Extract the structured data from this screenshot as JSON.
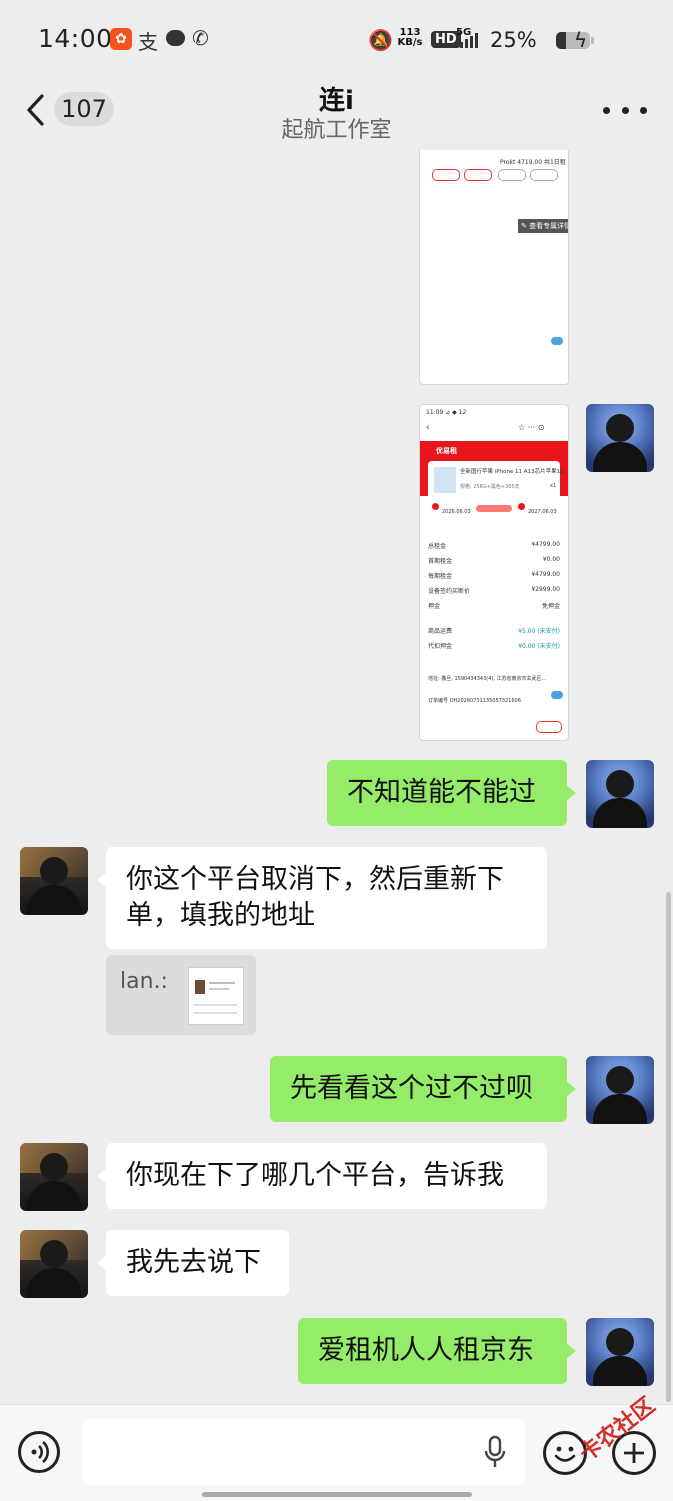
{
  "status_bar": {
    "time": "14:00",
    "app1": "😀",
    "alipay": "支",
    "network_speed_value": "113",
    "network_speed_unit": "KB/s",
    "hd": "HD",
    "signal": "5G",
    "battery": "25%"
  },
  "header": {
    "unread_count": "107",
    "title": "连i",
    "subtitle": "起航工作室"
  },
  "messages": [
    {
      "side": "me",
      "type": "image",
      "description": "partial order screenshot"
    },
    {
      "side": "me",
      "type": "image",
      "description": "order detail screenshot"
    },
    {
      "side": "me",
      "type": "text",
      "text": "不知道能不能过"
    },
    {
      "side": "other",
      "type": "text",
      "text": "你这个平台取消下，然后重新下单，填我的地址"
    },
    {
      "side": "other",
      "type": "quote",
      "label": "lan.:"
    },
    {
      "side": "me",
      "type": "text",
      "text": "先看看这个过不过呗"
    },
    {
      "side": "other",
      "type": "text",
      "text": "你现在下了哪几个平台，告诉我"
    },
    {
      "side": "other",
      "type": "text",
      "text": "我先去说下"
    },
    {
      "side": "me",
      "type": "text",
      "text": "爱租机人人租京东"
    }
  ],
  "screenshot1": {
    "top_line": "Prokt 4719.00 共1日租",
    "button_edit": "✎ 查看专属详情"
  },
  "screenshot2": {
    "status": "11:09 ⊿ ◆ 12",
    "store": "优易租",
    "product": "全新国行苹果 iPhone 11 A13芯片苹果11",
    "spec": "规格: 256G+黑色+365天",
    "qty": "x1",
    "start_date": "2026.06.03",
    "end_date": "2027.06.03",
    "rows": [
      {
        "label": "总租金",
        "value": "¥4799.00"
      },
      {
        "label": "首期租金",
        "value": "¥0.00"
      },
      {
        "label": "每期租金",
        "value": "¥4799.00"
      },
      {
        "label": "设备签约买断价",
        "value": "¥2999.00"
      },
      {
        "label": "押金",
        "value": "免押金"
      },
      {
        "label": "商品运费",
        "value": "¥5.00 (未支付)"
      },
      {
        "label": "代扣押金",
        "value": "¥0.00 (未支付)"
      }
    ],
    "address": "地址: 撒旦, 1590434343(4), 江苏省南京市玄武区...",
    "order_no": "订单编号 OH20260731135057321606"
  },
  "input_bar": {
    "placeholder": ""
  },
  "watermark": "卡农社区",
  "colors": {
    "my_bubble": "#95ec69",
    "other_bubble": "#ffffff",
    "background": "#ededed",
    "accent_red": "#e8161b"
  }
}
